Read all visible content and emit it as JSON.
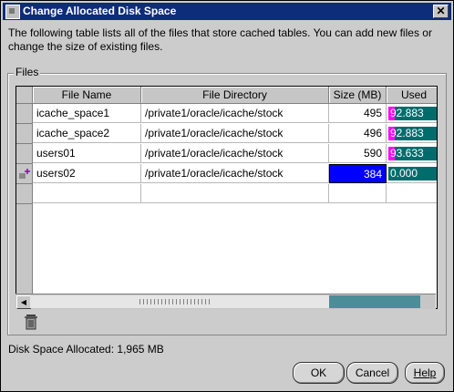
{
  "window": {
    "title": "Change Allocated Disk Space",
    "close_glyph": "✕"
  },
  "description": "The following table lists all of the files that store cached tables.  You can add new files or change the size of existing files.",
  "group": {
    "label": "Files"
  },
  "table": {
    "headers": [
      "File Name",
      "File Directory",
      "Size (MB)",
      "Used"
    ],
    "rows": [
      {
        "name": "icache_space1",
        "dir": "/private1/oracle/icache/stock",
        "size": "495",
        "used": "92.883",
        "used_pct": 0.13
      },
      {
        "name": "icache_space2",
        "dir": "/private1/oracle/icache/stock",
        "size": "496",
        "used": "92.883",
        "used_pct": 0.13
      },
      {
        "name": "users01",
        "dir": "/private1/oracle/icache/stock",
        "size": "590",
        "used": "93.633",
        "used_pct": 0.13
      },
      {
        "name": "users02",
        "dir": "/private1/oracle/icache/stock",
        "size": "384",
        "used": "0.000",
        "used_pct": 0.0
      }
    ],
    "selected_row": 3
  },
  "status": {
    "label": "Disk Space Allocated:",
    "value": "1,965 MB"
  },
  "buttons": {
    "ok": "OK",
    "cancel": "Cancel",
    "help": "Help"
  },
  "icons": {
    "trash": "trash-icon",
    "new_row": "new-row-icon"
  },
  "colors": {
    "titlebar": "#0d2c7a",
    "selection": "#0000ff",
    "bar_bg": "#006c6c",
    "bar_fill": "#ff00ff"
  }
}
